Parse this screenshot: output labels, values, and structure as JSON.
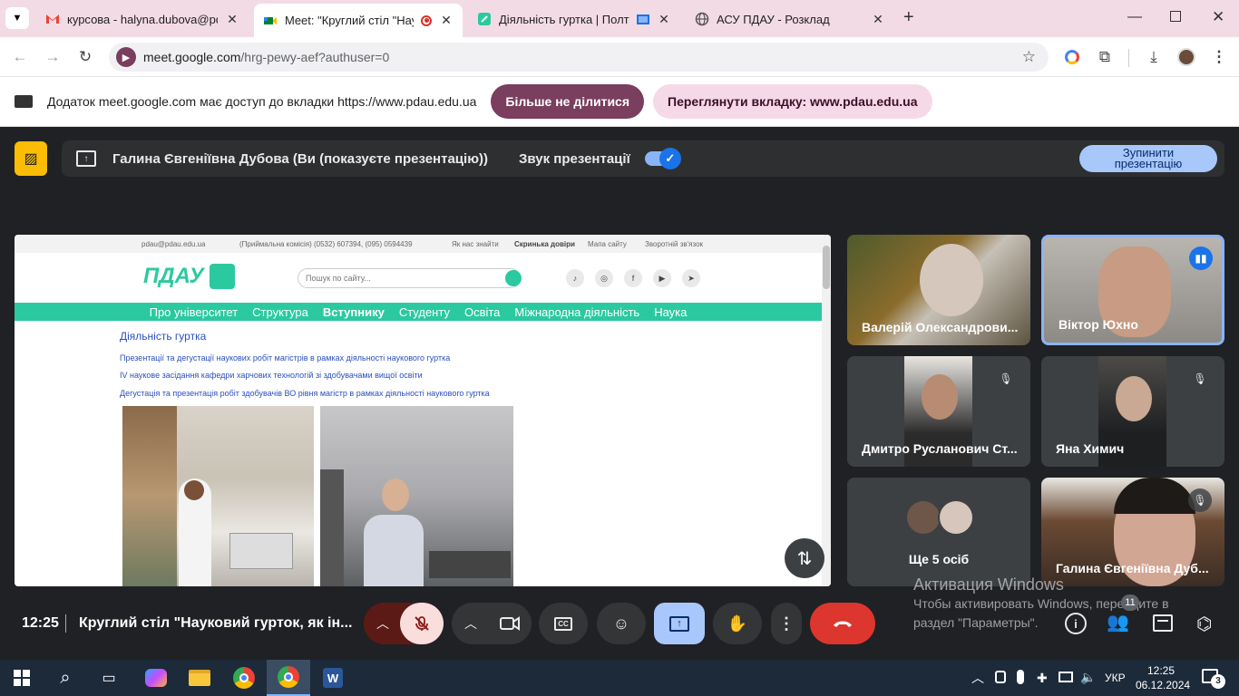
{
  "browser": {
    "tabs": [
      {
        "title": "курсова - halyna.dubova@pdau",
        "icon": "gmail-icon"
      },
      {
        "title": "Meet: \"Круглий стіл \"Наукові",
        "icon": "meet-icon",
        "active": true
      },
      {
        "title": "Діяльність гуртка | Полтавсь",
        "icon": "pdau-icon"
      },
      {
        "title": "АСУ ПДАУ - Розклад",
        "icon": "globe-icon"
      }
    ],
    "new_tab": "+",
    "url_domain": "meet.google.com",
    "url_path": "/hrg-pewy-aef?authuser=0"
  },
  "sharebar": {
    "message": "Додаток meet.google.com має доступ до вкладки https://www.pdau.edu.ua",
    "stop_sharing": "Більше не ділитися",
    "view_tab": "Переглянути вкладку: www.pdau.edu.ua"
  },
  "presenting": {
    "title": "Галина Євгеніївна Дубова (Ви (показуєте презентацію))",
    "audio_label": "Звук презентації",
    "audio_on": true,
    "stop_label_1": "Зупинити",
    "stop_label_2": "презентацію"
  },
  "shared_page": {
    "topbar": {
      "email": "pdau@pdau.edu.ua",
      "phone": "(Приймальна комісія)  (0532) 607394,  (095) 0594439",
      "links": [
        "Як нас знайти",
        "Скринька довіри",
        "Мапа сайту",
        "Зворотній зв'язок"
      ]
    },
    "logo": "ПДАУ",
    "search_placeholder": "Пошук по сайту...",
    "nav": [
      "Про університет",
      "Структура",
      "Вступнику",
      "Студенту",
      "Освіта",
      "Міжнародна діяльність",
      "Наука"
    ],
    "heading": "Діяльність гуртка",
    "links": [
      "Презентації та дегустації наукових робіт магістрів в рамках діяльності наукового гуртка",
      "IV наукове засідання кафедри харчових технологій зі здобувачами вищої освіти",
      "Дегустація та презентація робіт здобувачів ВО рівня магістр в рамках діяльності наукового гуртка"
    ]
  },
  "participants": [
    {
      "name": "Валерій Олександрови...",
      "muted": false
    },
    {
      "name": "Віктор Юхно",
      "muted": false,
      "speaking": true
    },
    {
      "name": "Дмитро Русланович Ст...",
      "muted": true
    },
    {
      "name": "Яна Химич",
      "muted": true
    },
    {
      "name": "Ще 5 осіб",
      "muted": false
    },
    {
      "name": "Галина Євгеніївна Дуб...",
      "muted": true
    }
  ],
  "bottombar": {
    "time": "12:25",
    "meeting_title": "Круглий стіл \"Науковий гурток, як ін...",
    "people_count": "11"
  },
  "watermark": {
    "line1": "Активация Windows",
    "line2": "Чтобы активировать Windows, перейдите в",
    "line3": "раздел \"Параметры\"."
  },
  "taskbar": {
    "lang": "УКР",
    "time": "12:25",
    "date": "06.12.2024",
    "notifications": "3"
  }
}
